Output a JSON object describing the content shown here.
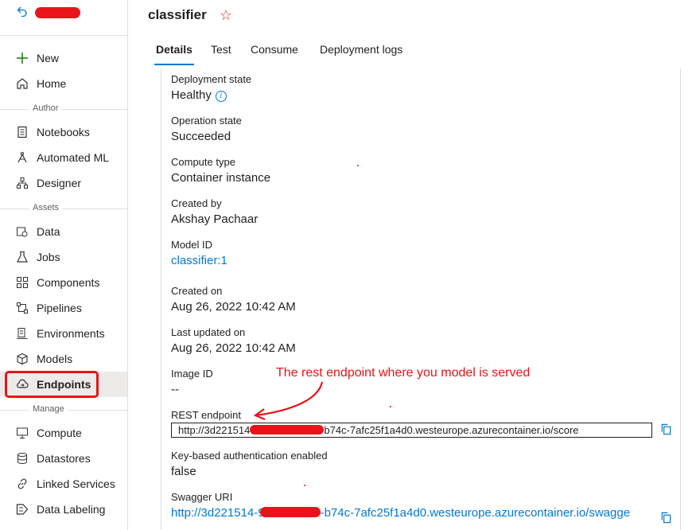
{
  "sidebar": {
    "items": [
      {
        "name": "new",
        "label": "New",
        "icon": "plus-icon"
      },
      {
        "name": "home",
        "label": "Home",
        "icon": "home-icon"
      },
      {
        "name": "notebooks",
        "label": "Notebooks",
        "icon": "notebook-icon"
      },
      {
        "name": "automated-ml",
        "label": "Automated ML",
        "icon": "automl-icon"
      },
      {
        "name": "designer",
        "label": "Designer",
        "icon": "designer-icon"
      },
      {
        "name": "data",
        "label": "Data",
        "icon": "data-icon"
      },
      {
        "name": "jobs",
        "label": "Jobs",
        "icon": "flask-icon"
      },
      {
        "name": "components",
        "label": "Components",
        "icon": "components-icon"
      },
      {
        "name": "pipelines",
        "label": "Pipelines",
        "icon": "pipeline-icon"
      },
      {
        "name": "environments",
        "label": "Environments",
        "icon": "environment-icon"
      },
      {
        "name": "models",
        "label": "Models",
        "icon": "cube-icon"
      },
      {
        "name": "endpoints",
        "label": "Endpoints",
        "icon": "cloud-endpoint-icon",
        "active": true
      },
      {
        "name": "compute",
        "label": "Compute",
        "icon": "monitor-icon"
      },
      {
        "name": "datastores",
        "label": "Datastores",
        "icon": "database-icon"
      },
      {
        "name": "linked-services",
        "label": "Linked Services",
        "icon": "link-icon"
      },
      {
        "name": "data-labeling",
        "label": "Data Labeling",
        "icon": "label-icon"
      }
    ],
    "sections": {
      "author": "Author",
      "assets": "Assets",
      "manage": "Manage"
    }
  },
  "header": {
    "title": "classifier",
    "favorite_icon": "star-icon"
  },
  "tabs": [
    "Details",
    "Test",
    "Consume",
    "Deployment logs"
  ],
  "details": {
    "deployment_state": {
      "label": "Deployment state",
      "value": "Healthy"
    },
    "operation_state": {
      "label": "Operation state",
      "value": "Succeeded"
    },
    "compute_type": {
      "label": "Compute type",
      "value": "Container instance"
    },
    "created_by": {
      "label": "Created by",
      "value": "Akshay Pachaar"
    },
    "model_id": {
      "label": "Model ID",
      "value": "classifier:1"
    },
    "created_on": {
      "label": "Created on",
      "value": "Aug 26, 2022 10:42 AM"
    },
    "last_updated_on": {
      "label": "Last updated on",
      "value": "Aug 26, 2022 10:42 AM"
    },
    "image_id": {
      "label": "Image ID",
      "value": "--"
    },
    "rest_endpoint": {
      "label": "REST endpoint",
      "value_start": "http://3d221514",
      "value_end": "b74c-7afc25f1a4d0.westeurope.azurecontainer.io/score"
    },
    "key_auth": {
      "label": "Key-based authentication enabled",
      "value": "false"
    },
    "swagger_uri": {
      "label": "Swagger URI",
      "value_start": "http://3d221514-9",
      "value_end": "-b74c-7afc25f1a4d0.westeurope.azurecontainer.io/swagge"
    }
  },
  "annotation": {
    "text": "The rest endpoint where you model is served",
    "color": "#e8141a"
  },
  "colors": {
    "accent": "#0078d4",
    "annotation_red": "#e8141a"
  }
}
